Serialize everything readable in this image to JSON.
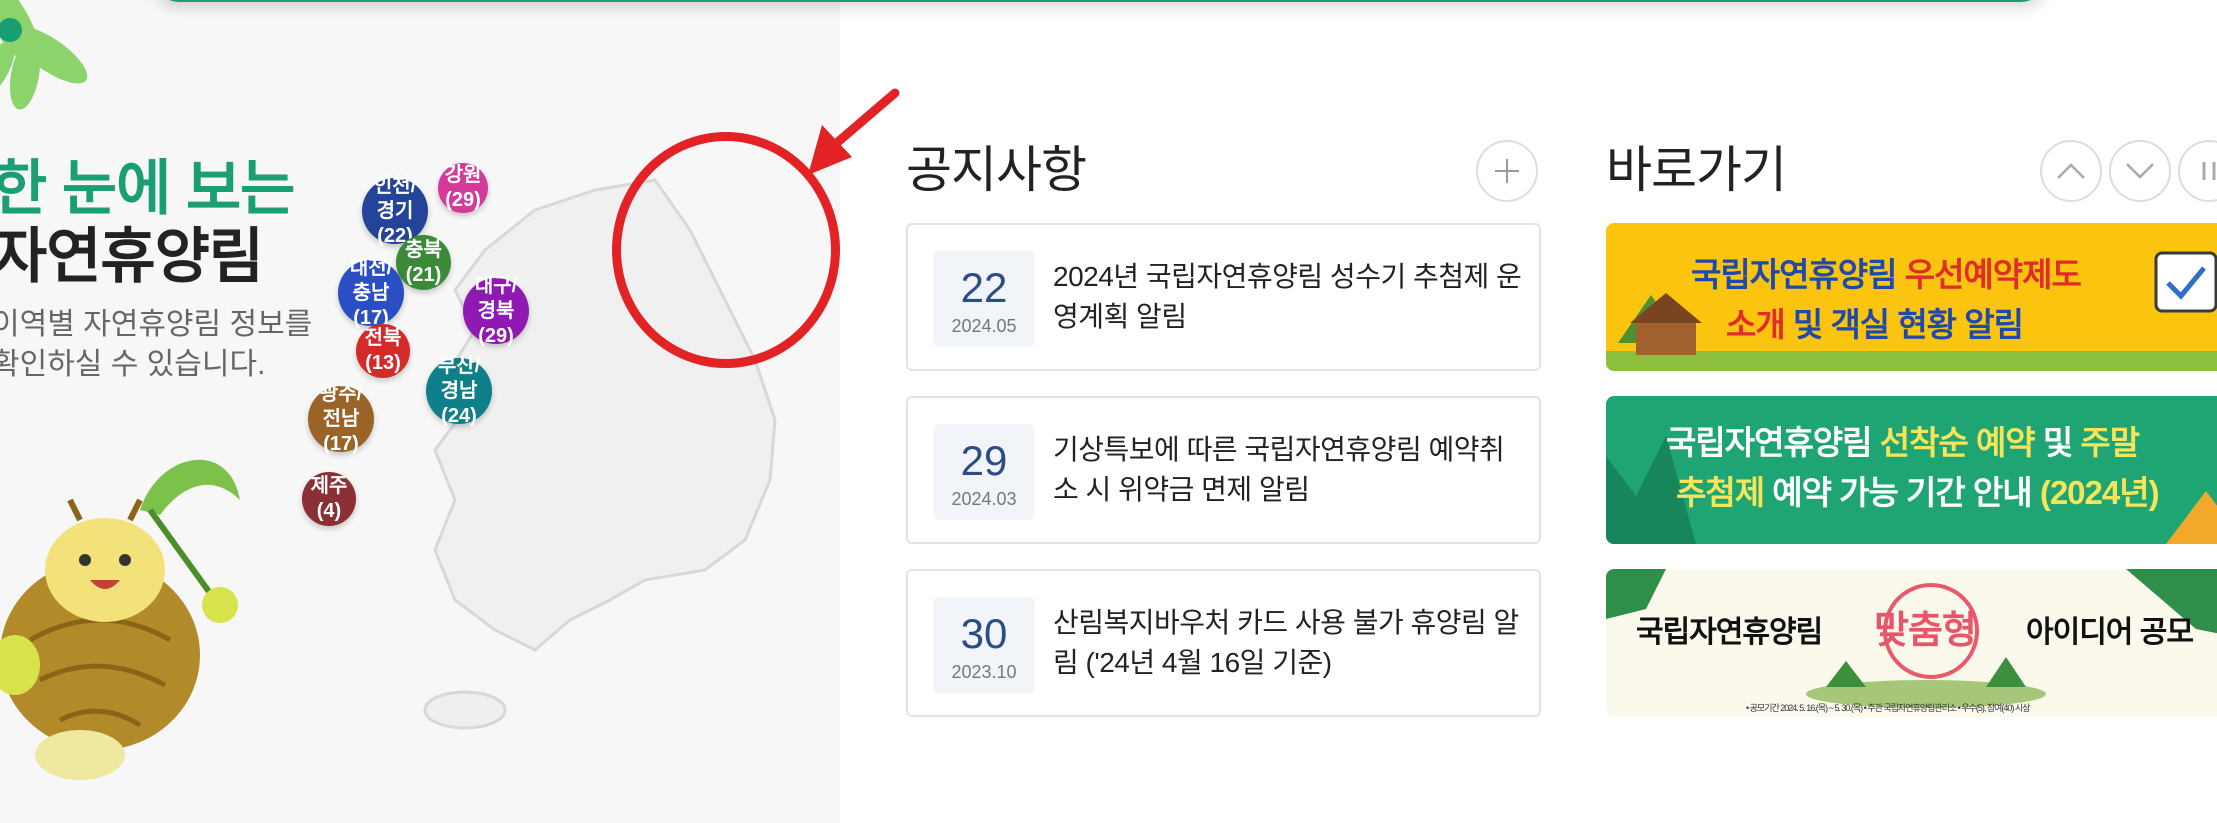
{
  "left": {
    "title_line1": "한 눈에 보는",
    "title_line2": "자연휴양림",
    "desc_line1": "이역별 자연휴양림 정보를",
    "desc_line2": "확인하실 수 있습니다."
  },
  "regions": [
    {
      "name": "인천/\n경기",
      "count": "(22)",
      "color": "#24449a"
    },
    {
      "name": "강원",
      "count": "(29)",
      "color": "#d43a9a"
    },
    {
      "name": "충북",
      "count": "(21)",
      "color": "#3b8a3a"
    },
    {
      "name": "대전/\n충남",
      "count": "(17)",
      "color": "#2a4fc4"
    },
    {
      "name": "대구/\n경북",
      "count": "(29)",
      "color": "#8e1ab3"
    },
    {
      "name": "전북",
      "count": "(13)",
      "color": "#d42a2a"
    },
    {
      "name": "부산/\n경남",
      "count": "(24)",
      "color": "#0f7f8a"
    },
    {
      "name": "광주/\n전남",
      "count": "(17)",
      "color": "#9a6328"
    },
    {
      "name": "제주",
      "count": "(4)",
      "color": "#8a2f33"
    }
  ],
  "notice": {
    "title": "공지사항",
    "items": [
      {
        "day": "22",
        "ym": "2024.05",
        "text": "2024년 국립자연휴양림 성수기 추첨제 운영계획 알림"
      },
      {
        "day": "29",
        "ym": "2024.03",
        "text": "기상특보에 따른 국립자연휴양림 예약취소 시 위약금 면제 알림"
      },
      {
        "day": "30",
        "ym": "2023.10",
        "text": "산림복지바우처 카드 사용 불가 휴양림 알림 ('24년 4월 16일 기준)"
      }
    ]
  },
  "shortcut": {
    "title": "바로가기",
    "banners": [
      {
        "line1a": "국립자연휴양림 ",
        "line1b": "우선예약제도",
        "line2a": "소개",
        "line2b": " 및 ",
        "line2c": "객실 현황 알림"
      },
      {
        "line1a": "국립자연휴양림 ",
        "line1b": "선착순 예약",
        "line1c": " 및 ",
        "line1d": "주말",
        "line2a": "추첨제",
        "line2b": " 예약 가능 기간 안내 ",
        "line2c": "(2024년)"
      },
      {
        "line1a": "국립자연휴양림",
        "line1b": "맞춤형",
        "line1c": "아이디어 공모",
        "small": "• 공모기간 2024. 5. 16.(목) ~ 5. 30.(목)  • 주관 국립자연휴양림관리소  • 우수(5), 참여(40) 시상"
      }
    ]
  }
}
